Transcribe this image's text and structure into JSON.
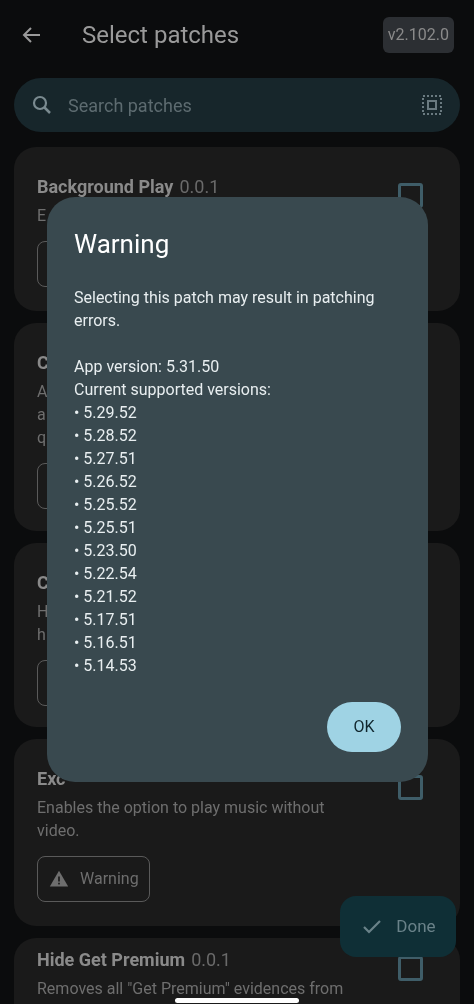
{
  "header": {
    "title": "Select patches",
    "version": "v2.102.0"
  },
  "search": {
    "placeholder": "Search patches"
  },
  "patches": [
    {
      "name": "Background Play",
      "version": "0.0.1",
      "description": [
        "E"
      ],
      "checked": false,
      "chip": {
        "kind": "outline"
      }
    },
    {
      "name": "C",
      "description": [
        "A",
        "a",
        "q"
      ],
      "chip": {
        "kind": "outline"
      }
    },
    {
      "name": "C",
      "description": [
        "H",
        "h"
      ],
      "chip": {
        "kind": "outline"
      }
    },
    {
      "name": "Exc",
      "description": [
        "Enables the option to play music without video."
      ],
      "checked": false,
      "chip": {
        "kind": "labeled",
        "label": "Warning"
      }
    },
    {
      "name": "Hide Get Premium",
      "version": "0.0.1",
      "description": [
        "Removes all \"Get Premium\" evidences from"
      ],
      "checked": false
    }
  ],
  "done_button": {
    "label": "Done"
  },
  "dialog": {
    "title": "Warning",
    "message": "Selecting this patch may result in patching errors.",
    "app_version": "App version: 5.31.50",
    "supported_heading": "Current supported versions:",
    "versions": [
      "• 5.29.52",
      "• 5.28.52",
      "• 5.27.51",
      "• 5.26.52",
      "• 5.25.52",
      "• 5.25.51",
      "• 5.23.50",
      "• 5.22.54",
      "• 5.21.52",
      "• 5.17.51",
      "• 5.16.51",
      "• 5.14.53"
    ],
    "ok_button": "OK"
  }
}
